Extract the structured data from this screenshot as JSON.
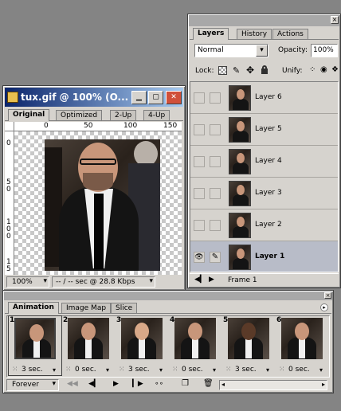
{
  "doc_window": {
    "title": "tux.gif @ 100% (O...",
    "tabs": [
      "Original",
      "Optimized",
      "2-Up",
      "4-Up"
    ],
    "ruler_top": [
      "0",
      "50",
      "100",
      "150"
    ],
    "ruler_left": [
      "0",
      "5 0",
      "1 0 0",
      "1 5"
    ],
    "zoom_value": "100%",
    "status_text": "-- / -- sec @ 28.8 Kbps"
  },
  "layers_panel": {
    "tabs": [
      "Layers",
      "History",
      "Actions"
    ],
    "blend_mode": "Normal",
    "opacity_label": "Opacity:",
    "opacity_value": "100%",
    "lock_label": "Lock:",
    "unify_label": "Unify:",
    "layers": [
      {
        "name": "Layer 6",
        "visible": false,
        "selected": false
      },
      {
        "name": "Layer 5",
        "visible": false,
        "selected": false
      },
      {
        "name": "Layer 4",
        "visible": false,
        "selected": false
      },
      {
        "name": "Layer 3",
        "visible": false,
        "selected": false
      },
      {
        "name": "Layer 2",
        "visible": false,
        "selected": false
      },
      {
        "name": "Layer 1",
        "visible": true,
        "selected": true
      }
    ],
    "frame_label": "Frame 1"
  },
  "animation_panel": {
    "tabs": [
      "Animation",
      "Image Map",
      "Slice"
    ],
    "frames": [
      {
        "num": "1",
        "delay": "3 sec."
      },
      {
        "num": "2",
        "delay": "0 sec."
      },
      {
        "num": "3",
        "delay": "3 sec."
      },
      {
        "num": "4",
        "delay": "0 sec."
      },
      {
        "num": "5",
        "delay": "3 sec."
      },
      {
        "num": "6",
        "delay": "0 sec."
      }
    ],
    "loop_value": "Forever"
  },
  "colors": {
    "desktop": "#848484",
    "title_active": "#0a246a",
    "title_inactive": "#808080",
    "panel": "#d6d3ce",
    "selected_row": "#b8bcc8"
  }
}
